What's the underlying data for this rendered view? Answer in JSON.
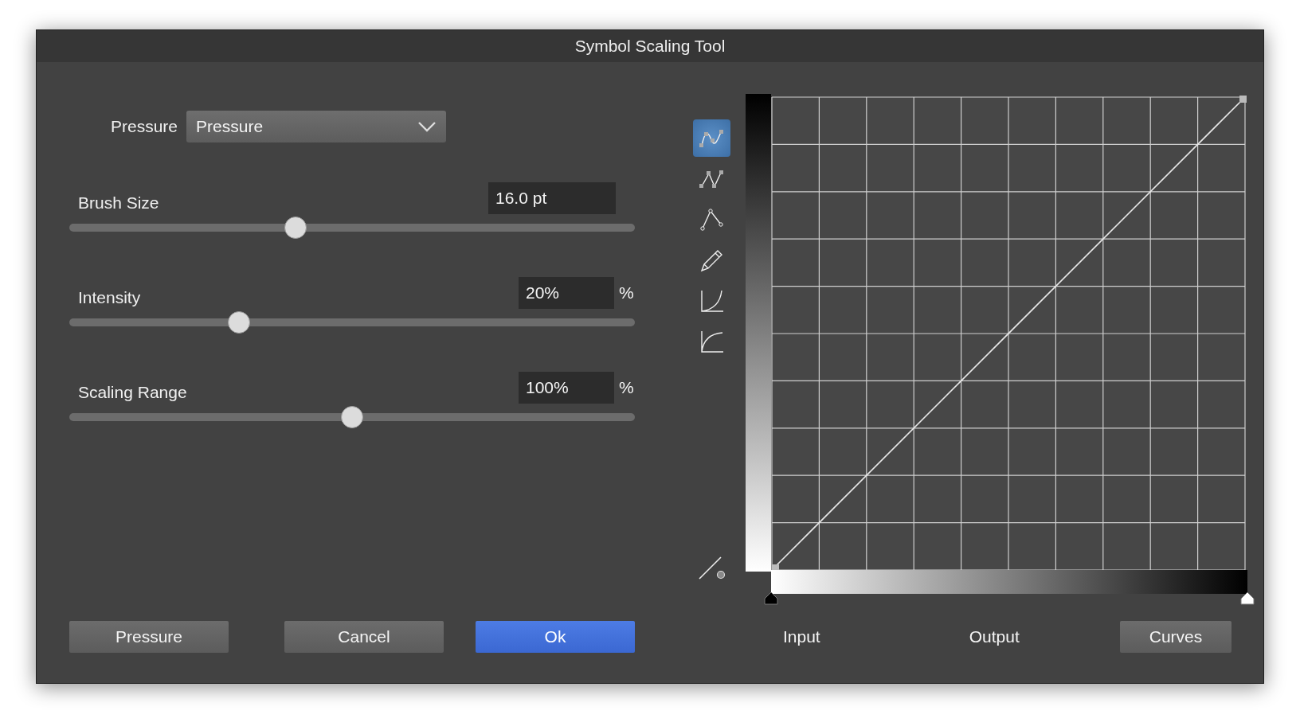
{
  "window": {
    "title": "Symbol Scaling Tool"
  },
  "pressure": {
    "label": "Pressure",
    "value": "Pressure"
  },
  "sliders": [
    {
      "label": "Brush Size",
      "value": "16.0 pt",
      "level": 0.4
    },
    {
      "label": "Intensity",
      "value": "20%",
      "unit": "%",
      "level": 0.3
    },
    {
      "label": "Scaling Range",
      "value": "100%",
      "unit": "%",
      "level": 0.5
    }
  ],
  "curve_tools": [
    {
      "kind": "smooth",
      "selected": true
    },
    {
      "kind": "corner",
      "selected": false
    },
    {
      "kind": "polyline",
      "selected": false
    },
    {
      "kind": "pencil",
      "selected": false
    },
    {
      "kind": "ease-in",
      "selected": false
    },
    {
      "kind": "ease-out",
      "selected": false
    }
  ],
  "buttons": [
    {
      "label": "Pressure",
      "kind": "normal"
    },
    {
      "label": "Cancel",
      "kind": "normal"
    },
    {
      "label": "Ok",
      "kind": "default"
    }
  ],
  "graph_labels": [
    "Input",
    "Output"
  ],
  "curves_button": "Curves"
}
